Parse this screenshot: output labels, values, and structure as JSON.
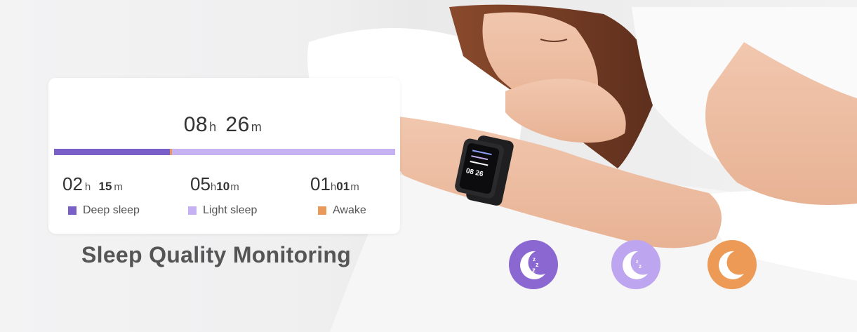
{
  "card": {
    "total": {
      "hours": "08",
      "h_unit": "h",
      "minutes": "26",
      "m_unit": "m"
    },
    "progress": [
      {
        "name": "deep",
        "fraction": 0.339,
        "color": "#7b5fc9"
      },
      {
        "name": "awake",
        "fraction": 0.006,
        "color": "#e99a5b"
      },
      {
        "name": "light",
        "fraction": 0.655,
        "color": "#c6b2f3"
      }
    ],
    "stats": {
      "deep": {
        "hours": "02",
        "h_unit": "h",
        "minutes": "15",
        "m_unit": "m",
        "label": "Deep sleep",
        "color": "#7b5fc9"
      },
      "light": {
        "hours": "05",
        "h_unit": "h",
        "minutes": "10",
        "m_unit": "m",
        "label": "Light sleep",
        "color": "#c6b2f3"
      },
      "awake": {
        "hours": "01",
        "h_unit": "h",
        "minutes": "01",
        "m_unit": "m",
        "label": "Awake",
        "color": "#e99a5b"
      }
    }
  },
  "headline": "Sleep Quality Monitoring",
  "icons": [
    {
      "name": "deep-sleep-moon-icon",
      "color": "#8a67d1"
    },
    {
      "name": "light-sleep-moon-icon",
      "color": "#bda5ef"
    },
    {
      "name": "awake-moon-icon",
      "color": "#ec9a55"
    }
  ],
  "watch": {
    "screen_value": "08 26"
  }
}
